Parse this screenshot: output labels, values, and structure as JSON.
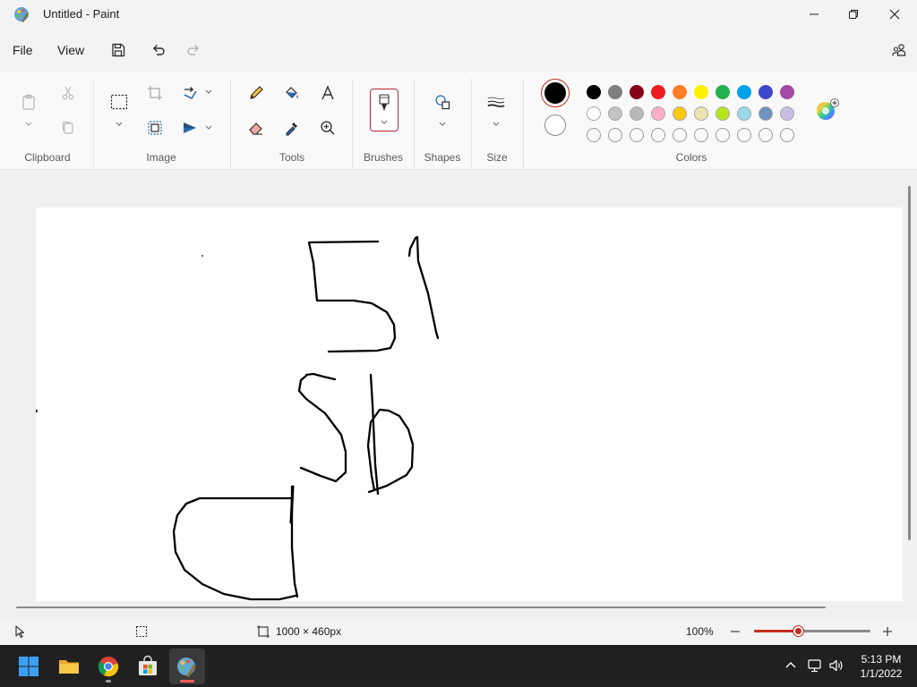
{
  "window": {
    "title": "Untitled - Paint"
  },
  "menu": {
    "file": "File",
    "view": "View"
  },
  "ribbon": {
    "groups": {
      "clipboard": "Clipboard",
      "image": "Image",
      "tools": "Tools",
      "brushes": "Brushes",
      "shapes": "Shapes",
      "size": "Size",
      "colors": "Colors"
    }
  },
  "colors": {
    "primary": "#000000",
    "secondary": "#ffffff",
    "palette_row1": [
      "#000000",
      "#7f7f7f",
      "#880015",
      "#ed1c24",
      "#ff7f27",
      "#fff200",
      "#22b14c",
      "#00a2e8",
      "#3f48cc",
      "#a349a4"
    ],
    "palette_row2": [
      "#ffffff",
      "#c3c3c3",
      "#b9b9b9",
      "#ffaec9",
      "#ffc90e",
      "#efe4b0",
      "#b5e61d",
      "#99d9ea",
      "#7092be",
      "#c8bfe7"
    ],
    "palette_row3_custom_slots": 10,
    "accent": "#c42b1c"
  },
  "statusbar": {
    "canvas_size": "1000 × 460px",
    "zoom": "100%",
    "zoom_slider_fraction": 0.38
  },
  "taskbar": {
    "apps": [
      "start",
      "file-explorer",
      "chrome",
      "microsoft-store",
      "paint"
    ],
    "active_app": "paint",
    "time": "5:13 PM",
    "date": "1/1/2022"
  }
}
